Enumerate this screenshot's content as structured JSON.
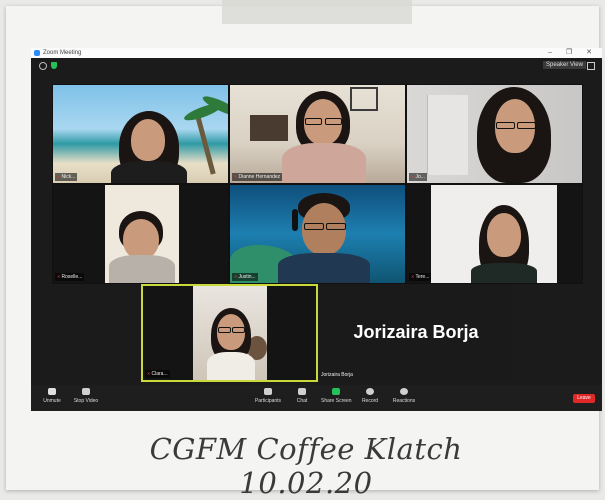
{
  "window": {
    "title": "Zoom Meeting",
    "controls": "– ❐ ✕",
    "speaker_view": "Speaker View"
  },
  "participants": [
    {
      "name": "Nick..."
    },
    {
      "name": "Dianne Hernandez"
    },
    {
      "name": "Jo..."
    },
    {
      "name": "Roselle..."
    },
    {
      "name": "Justin..."
    },
    {
      "name": "Tere..."
    },
    {
      "name": "Clara..."
    }
  ],
  "spotlight": {
    "name": "Jorizaira Borja",
    "small_label": "Jorizaira Borja"
  },
  "toolbar": {
    "unmute": "Unmute",
    "start_video": "Stop Video",
    "participants": "Participants",
    "chat": "Chat",
    "share_screen": "Share Screen",
    "record": "Record",
    "reactions": "Reactions",
    "leave": "Leave"
  },
  "caption": "CGFM Coffee Klatch 10.02.20"
}
